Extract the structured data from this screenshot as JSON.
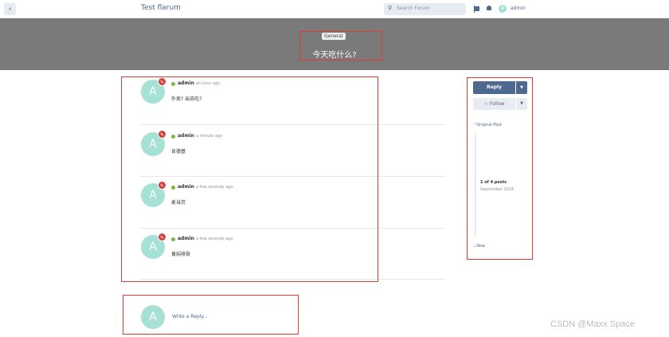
{
  "header": {
    "back_icon": "chevron-left-icon",
    "site_title": "Test flarum",
    "search_placeholder": "Search Forum",
    "user_initial": "A",
    "user_name": "admin"
  },
  "discussion": {
    "tag": "General",
    "title": "今天吃什么?"
  },
  "posts": [
    {
      "initial": "A",
      "author": "admin",
      "time": "an hour ago",
      "content": "外卖? 出去吃?"
    },
    {
      "initial": "A",
      "author": "admin",
      "time": "a minute ago",
      "content": "肯德基"
    },
    {
      "initial": "A",
      "author": "admin",
      "time": "a few seconds ago",
      "content": "麦当劳"
    },
    {
      "initial": "A",
      "author": "admin",
      "time": "a few seconds ago",
      "content": "黄焖排骨"
    }
  ],
  "reply_box": {
    "initial": "A",
    "placeholder": "Write a Reply..."
  },
  "sidebar": {
    "reply_label": "Reply",
    "follow_label": "Follow",
    "original_post_label": "Original Post",
    "position": "1 of 4 posts",
    "position_date": "September 2024",
    "now_label": "Now"
  },
  "colors": {
    "accent": "#4d698e",
    "hero": "#7a7a7a",
    "avatar": "#a6e1d5",
    "badge": "#d0413b",
    "online": "#7eb63f",
    "annotation": "#e53935"
  },
  "watermark": "CSDN @Maxx Space"
}
